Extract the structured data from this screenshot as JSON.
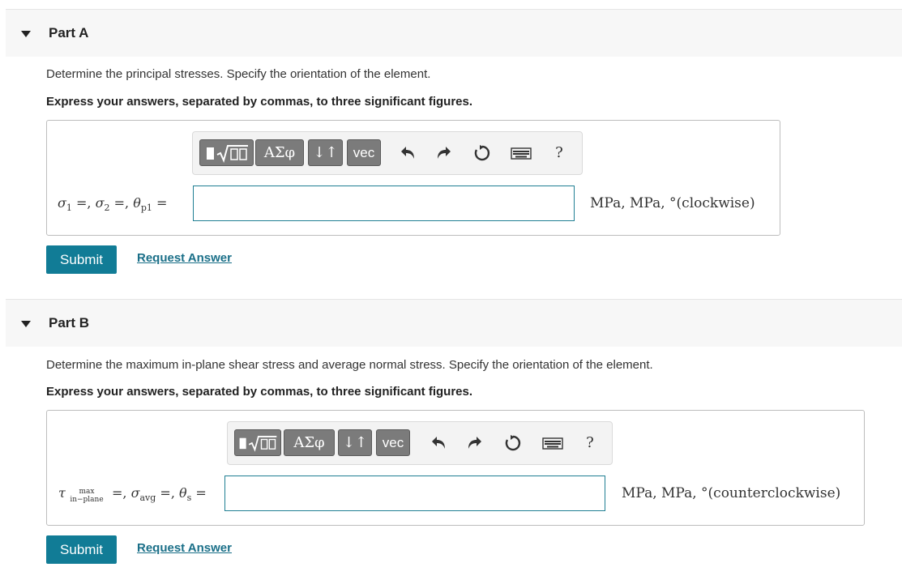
{
  "partA": {
    "header": "Part A",
    "prompt": "Determine the principal stresses. Specify the orientation of the element.",
    "instructions": "Express your answers, separated by commas, to three significant figures.",
    "toolbar": {
      "templates_icon": "sqrt-template-icon",
      "greek_label": "ΑΣφ",
      "arrows_label": "↓↑",
      "vec_label": "vec",
      "undo_icon": "undo-icon",
      "redo_icon": "redo-icon",
      "reset_icon": "reset-icon",
      "keyboard_icon": "keyboard-icon",
      "help_label": "?"
    },
    "label_s1": "σ",
    "label_s1_sub": "1",
    "label_s2": "σ",
    "label_s2_sub": "2",
    "label_th": "θ",
    "label_th_sub": "p1",
    "answer_value": "",
    "units": "MPa,  MPa,  °(clockwise)",
    "submit_label": "Submit",
    "request_label": "Request Answer"
  },
  "partB": {
    "header": "Part B",
    "prompt": "Determine the maximum in-plane shear stress and average normal stress. Specify the orientation of the element.",
    "instructions": "Express your answers, separated by commas, to three significant figures.",
    "toolbar": {
      "templates_icon": "sqrt-template-icon",
      "greek_label": "ΑΣφ",
      "arrows_label": "↓↑",
      "vec_label": "vec",
      "undo_icon": "undo-icon",
      "redo_icon": "redo-icon",
      "reset_icon": "reset-icon",
      "keyboard_icon": "keyboard-icon",
      "help_label": "?"
    },
    "label_tau": "τ",
    "label_tau_top": "max",
    "label_tau_bottom": "in−plane",
    "label_avg": "σ",
    "label_avg_sub": "avg",
    "label_th": "θ",
    "label_th_sub": "s",
    "answer_value": "",
    "units": "MPa,  MPa,  °(counterclockwise)",
    "submit_label": "Submit",
    "request_label": "Request Answer"
  }
}
